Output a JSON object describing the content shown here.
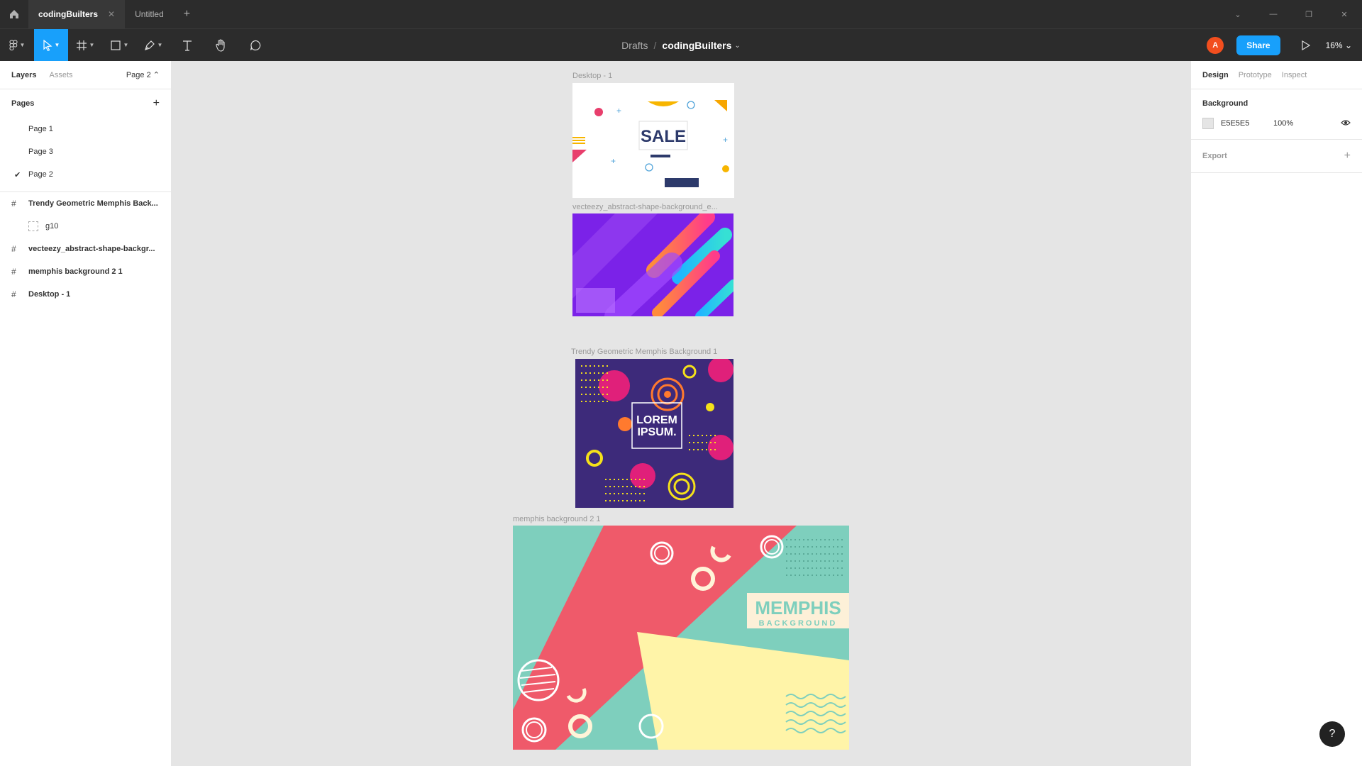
{
  "tabs": [
    {
      "label": "codingBuilters",
      "active": true
    },
    {
      "label": "Untitled",
      "active": false
    }
  ],
  "toolbar": {
    "breadcrumb_parent": "Drafts",
    "file_name": "codingBuilters",
    "share_label": "Share",
    "zoom": "16%",
    "avatar_initial": "A"
  },
  "left_panel": {
    "tabs": [
      "Layers",
      "Assets"
    ],
    "current_page": "Page 2",
    "pages_title": "Pages",
    "pages": [
      {
        "label": "Page 1",
        "selected": false
      },
      {
        "label": "Page 3",
        "selected": false
      },
      {
        "label": "Page 2",
        "selected": true
      }
    ],
    "layers": [
      {
        "label": "Trendy Geometric Memphis Back...",
        "type": "frame"
      },
      {
        "label": "g10",
        "type": "group"
      },
      {
        "label": "vecteezy_abstract-shape-backgr...",
        "type": "frame"
      },
      {
        "label": "memphis background 2 1",
        "type": "frame"
      },
      {
        "label": "Desktop - 1",
        "type": "frame"
      }
    ]
  },
  "right_panel": {
    "tabs": [
      "Design",
      "Prototype",
      "Inspect"
    ],
    "background_title": "Background",
    "bg_hex": "E5E5E5",
    "bg_opacity": "100%",
    "export_title": "Export"
  },
  "canvas": {
    "frames": [
      {
        "label": "Desktop - 1",
        "sale_text": "SALE"
      },
      {
        "label": "vecteezy_abstract-shape-background_e..."
      },
      {
        "label": "Trendy Geometric Memphis Background 1",
        "text_line1": "LOREM",
        "text_line2": "IPSUM."
      },
      {
        "label": "memphis background 2 1",
        "title": "MEMPHIS",
        "subtitle": "BACKGROUND"
      }
    ]
  },
  "colors": {
    "accent": "#18a0fb",
    "chrome": "#2c2c2c",
    "canvas_bg": "#e5e5e5"
  },
  "help_label": "?"
}
